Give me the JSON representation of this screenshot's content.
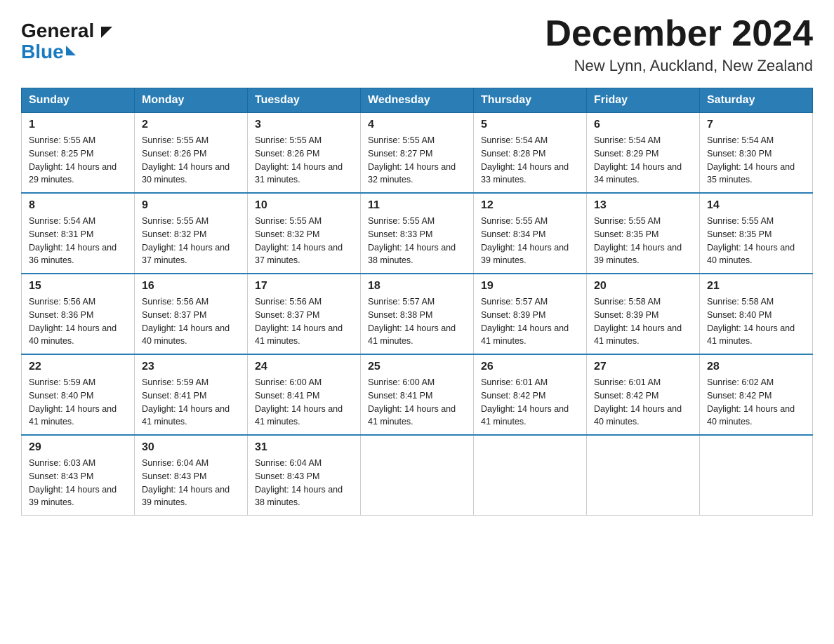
{
  "header": {
    "logo_general": "General",
    "logo_blue": "Blue",
    "month_title": "December 2024",
    "location": "New Lynn, Auckland, New Zealand"
  },
  "weekdays": [
    "Sunday",
    "Monday",
    "Tuesday",
    "Wednesday",
    "Thursday",
    "Friday",
    "Saturday"
  ],
  "weeks": [
    [
      {
        "num": "1",
        "sunrise": "5:55 AM",
        "sunset": "8:25 PM",
        "daylight": "14 hours and 29 minutes."
      },
      {
        "num": "2",
        "sunrise": "5:55 AM",
        "sunset": "8:26 PM",
        "daylight": "14 hours and 30 minutes."
      },
      {
        "num": "3",
        "sunrise": "5:55 AM",
        "sunset": "8:26 PM",
        "daylight": "14 hours and 31 minutes."
      },
      {
        "num": "4",
        "sunrise": "5:55 AM",
        "sunset": "8:27 PM",
        "daylight": "14 hours and 32 minutes."
      },
      {
        "num": "5",
        "sunrise": "5:54 AM",
        "sunset": "8:28 PM",
        "daylight": "14 hours and 33 minutes."
      },
      {
        "num": "6",
        "sunrise": "5:54 AM",
        "sunset": "8:29 PM",
        "daylight": "14 hours and 34 minutes."
      },
      {
        "num": "7",
        "sunrise": "5:54 AM",
        "sunset": "8:30 PM",
        "daylight": "14 hours and 35 minutes."
      }
    ],
    [
      {
        "num": "8",
        "sunrise": "5:54 AM",
        "sunset": "8:31 PM",
        "daylight": "14 hours and 36 minutes."
      },
      {
        "num": "9",
        "sunrise": "5:55 AM",
        "sunset": "8:32 PM",
        "daylight": "14 hours and 37 minutes."
      },
      {
        "num": "10",
        "sunrise": "5:55 AM",
        "sunset": "8:32 PM",
        "daylight": "14 hours and 37 minutes."
      },
      {
        "num": "11",
        "sunrise": "5:55 AM",
        "sunset": "8:33 PM",
        "daylight": "14 hours and 38 minutes."
      },
      {
        "num": "12",
        "sunrise": "5:55 AM",
        "sunset": "8:34 PM",
        "daylight": "14 hours and 39 minutes."
      },
      {
        "num": "13",
        "sunrise": "5:55 AM",
        "sunset": "8:35 PM",
        "daylight": "14 hours and 39 minutes."
      },
      {
        "num": "14",
        "sunrise": "5:55 AM",
        "sunset": "8:35 PM",
        "daylight": "14 hours and 40 minutes."
      }
    ],
    [
      {
        "num": "15",
        "sunrise": "5:56 AM",
        "sunset": "8:36 PM",
        "daylight": "14 hours and 40 minutes."
      },
      {
        "num": "16",
        "sunrise": "5:56 AM",
        "sunset": "8:37 PM",
        "daylight": "14 hours and 40 minutes."
      },
      {
        "num": "17",
        "sunrise": "5:56 AM",
        "sunset": "8:37 PM",
        "daylight": "14 hours and 41 minutes."
      },
      {
        "num": "18",
        "sunrise": "5:57 AM",
        "sunset": "8:38 PM",
        "daylight": "14 hours and 41 minutes."
      },
      {
        "num": "19",
        "sunrise": "5:57 AM",
        "sunset": "8:39 PM",
        "daylight": "14 hours and 41 minutes."
      },
      {
        "num": "20",
        "sunrise": "5:58 AM",
        "sunset": "8:39 PM",
        "daylight": "14 hours and 41 minutes."
      },
      {
        "num": "21",
        "sunrise": "5:58 AM",
        "sunset": "8:40 PM",
        "daylight": "14 hours and 41 minutes."
      }
    ],
    [
      {
        "num": "22",
        "sunrise": "5:59 AM",
        "sunset": "8:40 PM",
        "daylight": "14 hours and 41 minutes."
      },
      {
        "num": "23",
        "sunrise": "5:59 AM",
        "sunset": "8:41 PM",
        "daylight": "14 hours and 41 minutes."
      },
      {
        "num": "24",
        "sunrise": "6:00 AM",
        "sunset": "8:41 PM",
        "daylight": "14 hours and 41 minutes."
      },
      {
        "num": "25",
        "sunrise": "6:00 AM",
        "sunset": "8:41 PM",
        "daylight": "14 hours and 41 minutes."
      },
      {
        "num": "26",
        "sunrise": "6:01 AM",
        "sunset": "8:42 PM",
        "daylight": "14 hours and 41 minutes."
      },
      {
        "num": "27",
        "sunrise": "6:01 AM",
        "sunset": "8:42 PM",
        "daylight": "14 hours and 40 minutes."
      },
      {
        "num": "28",
        "sunrise": "6:02 AM",
        "sunset": "8:42 PM",
        "daylight": "14 hours and 40 minutes."
      }
    ],
    [
      {
        "num": "29",
        "sunrise": "6:03 AM",
        "sunset": "8:43 PM",
        "daylight": "14 hours and 39 minutes."
      },
      {
        "num": "30",
        "sunrise": "6:04 AM",
        "sunset": "8:43 PM",
        "daylight": "14 hours and 39 minutes."
      },
      {
        "num": "31",
        "sunrise": "6:04 AM",
        "sunset": "8:43 PM",
        "daylight": "14 hours and 38 minutes."
      },
      null,
      null,
      null,
      null
    ]
  ],
  "labels": {
    "sunrise_prefix": "Sunrise: ",
    "sunset_prefix": "Sunset: ",
    "daylight_prefix": "Daylight: "
  }
}
